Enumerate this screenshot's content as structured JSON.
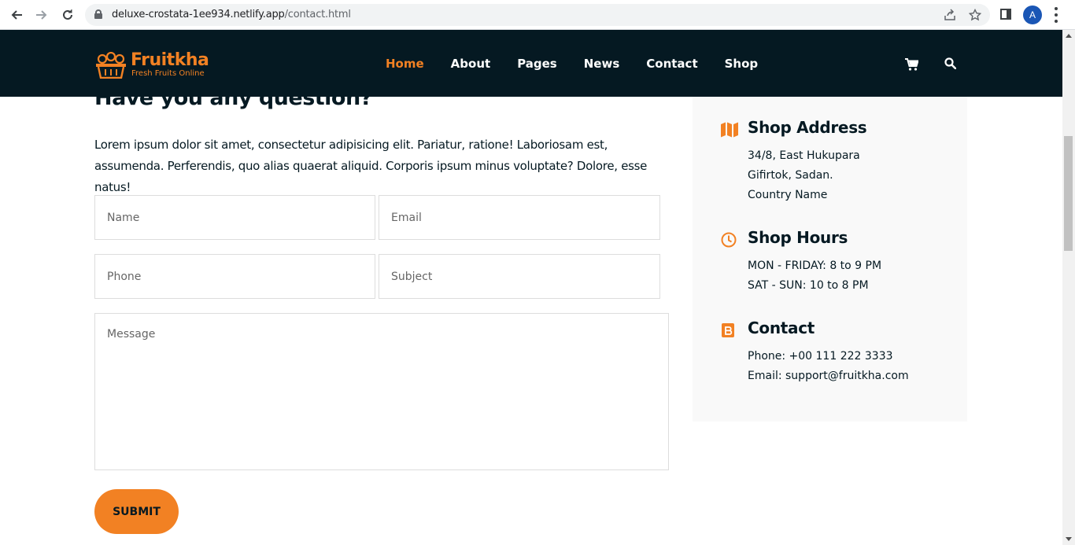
{
  "browser": {
    "url_domain": "deluxe-crostata-1ee934.netlify.app",
    "url_path": "/contact.html",
    "profile_initial": "A"
  },
  "site": {
    "logo_name": "Fruitkha",
    "logo_tagline": "Fresh Fruits Online",
    "menu": [
      {
        "label": "Home",
        "active": true
      },
      {
        "label": "About"
      },
      {
        "label": "Pages"
      },
      {
        "label": "News"
      },
      {
        "label": "Contact"
      },
      {
        "label": "Shop"
      }
    ],
    "accent_color": "#f28123",
    "dark_color": "#051922"
  },
  "contact_form": {
    "title": "Have you any question?",
    "description": "Lorem ipsum dolor sit amet, consectetur adipisicing elit. Pariatur, ratione! Laboriosam est, assumenda. Perferendis, quo alias quaerat aliquid. Corporis ipsum minus voluptate? Dolore, esse natus!",
    "name_placeholder": "Name",
    "email_placeholder": "Email",
    "phone_placeholder": "Phone",
    "subject_placeholder": "Subject",
    "message_placeholder": "Message",
    "submit_label": "SUBMIT"
  },
  "info": {
    "address": {
      "icon": "map-icon",
      "title": "Shop Address",
      "lines": [
        "34/8, East Hukupara",
        "Gifirtok, Sadan.",
        "Country Name"
      ]
    },
    "hours": {
      "icon": "clock-icon",
      "title": "Shop Hours",
      "lines": [
        "MON - FRIDAY: 8 to 9 PM",
        "SAT - SUN: 10 to 8 PM"
      ]
    },
    "contact": {
      "icon": "contact-card-icon",
      "title": "Contact",
      "lines": [
        "Phone: +00 111 222 3333",
        "Email: support@fruitkha.com"
      ]
    }
  }
}
